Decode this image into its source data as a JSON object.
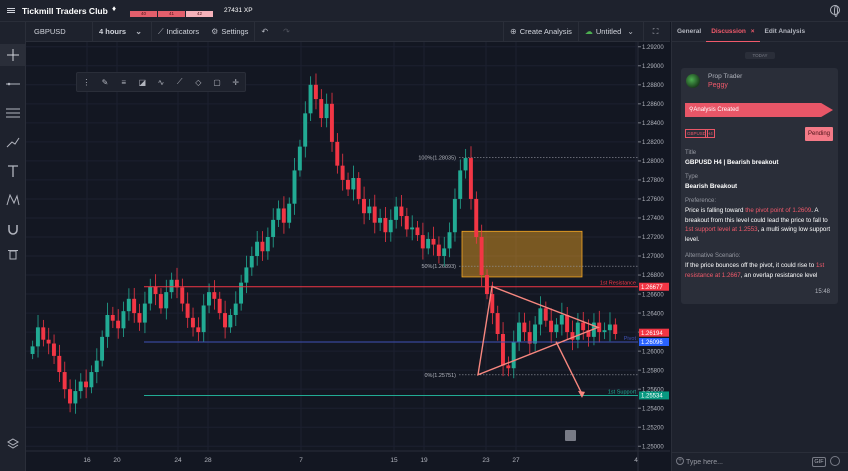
{
  "app": {
    "title": "Tickmill Traders Club",
    "xp_segments": [
      "40",
      "41",
      "42"
    ],
    "xp_label": "27431 XP"
  },
  "toolbar": {
    "symbol": "GBPUSD",
    "interval": "4 hours",
    "indicators_label": "Indicators",
    "settings_label": "Settings",
    "create_analysis_label": "Create Analysis",
    "untitled_label": "Untitled"
  },
  "chart_data": {
    "type": "candlestick",
    "symbol": "GBPUSD",
    "interval": "4 hours",
    "ylim": [
      1.2495,
      1.2925
    ],
    "price_ticks": [
      "1.29200",
      "1.29000",
      "1.28800",
      "1.28600",
      "1.28400",
      "1.28200",
      "1.28000",
      "1.27800",
      "1.27600",
      "1.27400",
      "1.27200",
      "1.27000",
      "1.26800",
      "1.26600",
      "1.26400",
      "1.26200",
      "1.26000",
      "1.25800",
      "1.25600",
      "1.25400",
      "1.25200",
      "1.25000"
    ],
    "date_ticks": [
      "16",
      "20",
      "24",
      "28",
      "7",
      "15",
      "19",
      "23",
      "27",
      "4"
    ],
    "price_labels": [
      {
        "text": "1.26677",
        "price": 1.26677,
        "color": "#f23645"
      },
      {
        "text": "1.26194",
        "price": 1.26194,
        "color": "#f23645"
      },
      {
        "text": "1.26096",
        "price": 1.26096,
        "color": "#2962ff"
      },
      {
        "text": "1.25534",
        "price": 1.25534,
        "color": "#089981"
      }
    ],
    "levels": [
      {
        "label": "1st Resistance",
        "price": 1.26677,
        "color": "#f23645"
      },
      {
        "label": "Pivot",
        "price": 1.26096,
        "color": "#3f51b5"
      },
      {
        "label": "1st Support",
        "price": 1.25534,
        "color": "#22ab94"
      }
    ],
    "fib": [
      {
        "label": "100%(1.28035)",
        "price": 1.28035
      },
      {
        "label": "50%(1.26893)",
        "price": 1.26893
      },
      {
        "label": "0%(1.25751)",
        "price": 1.25751
      }
    ],
    "zone": {
      "from": 1.2678,
      "to": 1.2726
    },
    "path": [
      1.2605,
      1.2625,
      1.2612,
      1.2608,
      1.2595,
      1.2578,
      1.256,
      1.2545,
      1.2558,
      1.2568,
      1.2562,
      1.2578,
      1.259,
      1.2615,
      1.2638,
      1.2632,
      1.2624,
      1.2642,
      1.2655,
      1.264,
      1.263,
      1.265,
      1.2668,
      1.266,
      1.2645,
      1.2662,
      1.2675,
      1.2667,
      1.265,
      1.2635,
      1.2625,
      1.262,
      1.2648,
      1.2662,
      1.2655,
      1.264,
      1.2625,
      1.2638,
      1.265,
      1.2672,
      1.2688,
      1.27,
      1.2715,
      1.2705,
      1.272,
      1.2738,
      1.275,
      1.2735,
      1.2755,
      1.279,
      1.2815,
      1.285,
      1.288,
      1.2865,
      1.2845,
      1.286,
      1.282,
      1.2795,
      1.278,
      1.277,
      1.2782,
      1.276,
      1.2745,
      1.2752,
      1.2735,
      1.274,
      1.2725,
      1.2738,
      1.2752,
      1.2742,
      1.2728,
      1.273,
      1.2722,
      1.2708,
      1.2718,
      1.2712,
      1.27,
      1.2708,
      1.2725,
      1.276,
      1.279,
      1.2803,
      1.276,
      1.272,
      1.268,
      1.266,
      1.264,
      1.2618,
      1.2585,
      1.2582,
      1.261,
      1.263,
      1.262,
      1.2608,
      1.2628,
      1.2645,
      1.2632,
      1.262,
      1.2628,
      1.2638,
      1.262,
      1.2612,
      1.263,
      1.2622,
      1.2615,
      1.263,
      1.262,
      1.2622,
      1.2628,
      1.2618
    ]
  },
  "right_panel": {
    "tabs": [
      "General",
      "Discussion",
      "Edit Analysis"
    ],
    "tab_close": "×",
    "today": "TODAY",
    "author_role": "Prop Trader",
    "author_name": "Peggy",
    "status_banner": "Analysis Created",
    "tags": [
      "GBPUSD",
      "H4"
    ],
    "pending_label": "Pending",
    "title_label": "Title",
    "title_value": "GBPUSD H4 | Bearish breakout",
    "type_label": "Type",
    "type_value": "Bearish Breakout",
    "preference_label": "Preference:",
    "preference_parts": [
      "Price is falling toward ",
      "the pivot point of 1.2609",
      ". A breakout from this level could lead the price to fall to ",
      "1st support level at 1.2553",
      ", a multi swing low support level."
    ],
    "alt_label": "Alternative Scenario:",
    "alt_parts": [
      "If the price bounces off the pivot, it could rise to ",
      "1st resistance at 1.2667",
      ", an overlap resistance level"
    ],
    "message_time": "15:48",
    "composer_placeholder": "Type here...",
    "gif_label": "GIF"
  },
  "icons": {
    "crosshair": "crosshair-icon",
    "trend_line": "trend-line-icon",
    "fib": "fib-retracement-icon",
    "brush": "brush-icon",
    "text": "text-icon",
    "pattern": "pattern-icon",
    "magnet": "magnet-icon",
    "trash": "trash-icon",
    "layers": "layers-icon"
  }
}
